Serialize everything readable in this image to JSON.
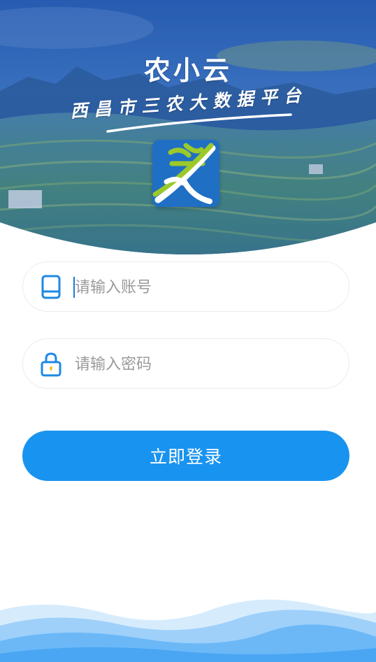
{
  "header": {
    "app_title": "农小云",
    "subtitle": "西昌市三农大数据平台",
    "logo_char": "農",
    "logo_icon": "nong-logo-icon"
  },
  "login_form": {
    "account": {
      "placeholder": "请输入账号",
      "value": "",
      "icon": "phone-icon"
    },
    "password": {
      "placeholder": "请输入密码",
      "value": "",
      "icon": "lock-icon"
    },
    "submit_label": "立即登录"
  },
  "colors": {
    "primary": "#1993f0",
    "icon_blue": "#1e88e5",
    "lock_dot": "#f5b800",
    "logo_bg": "#1f6fc4",
    "logo_green": "#9bc92a"
  }
}
